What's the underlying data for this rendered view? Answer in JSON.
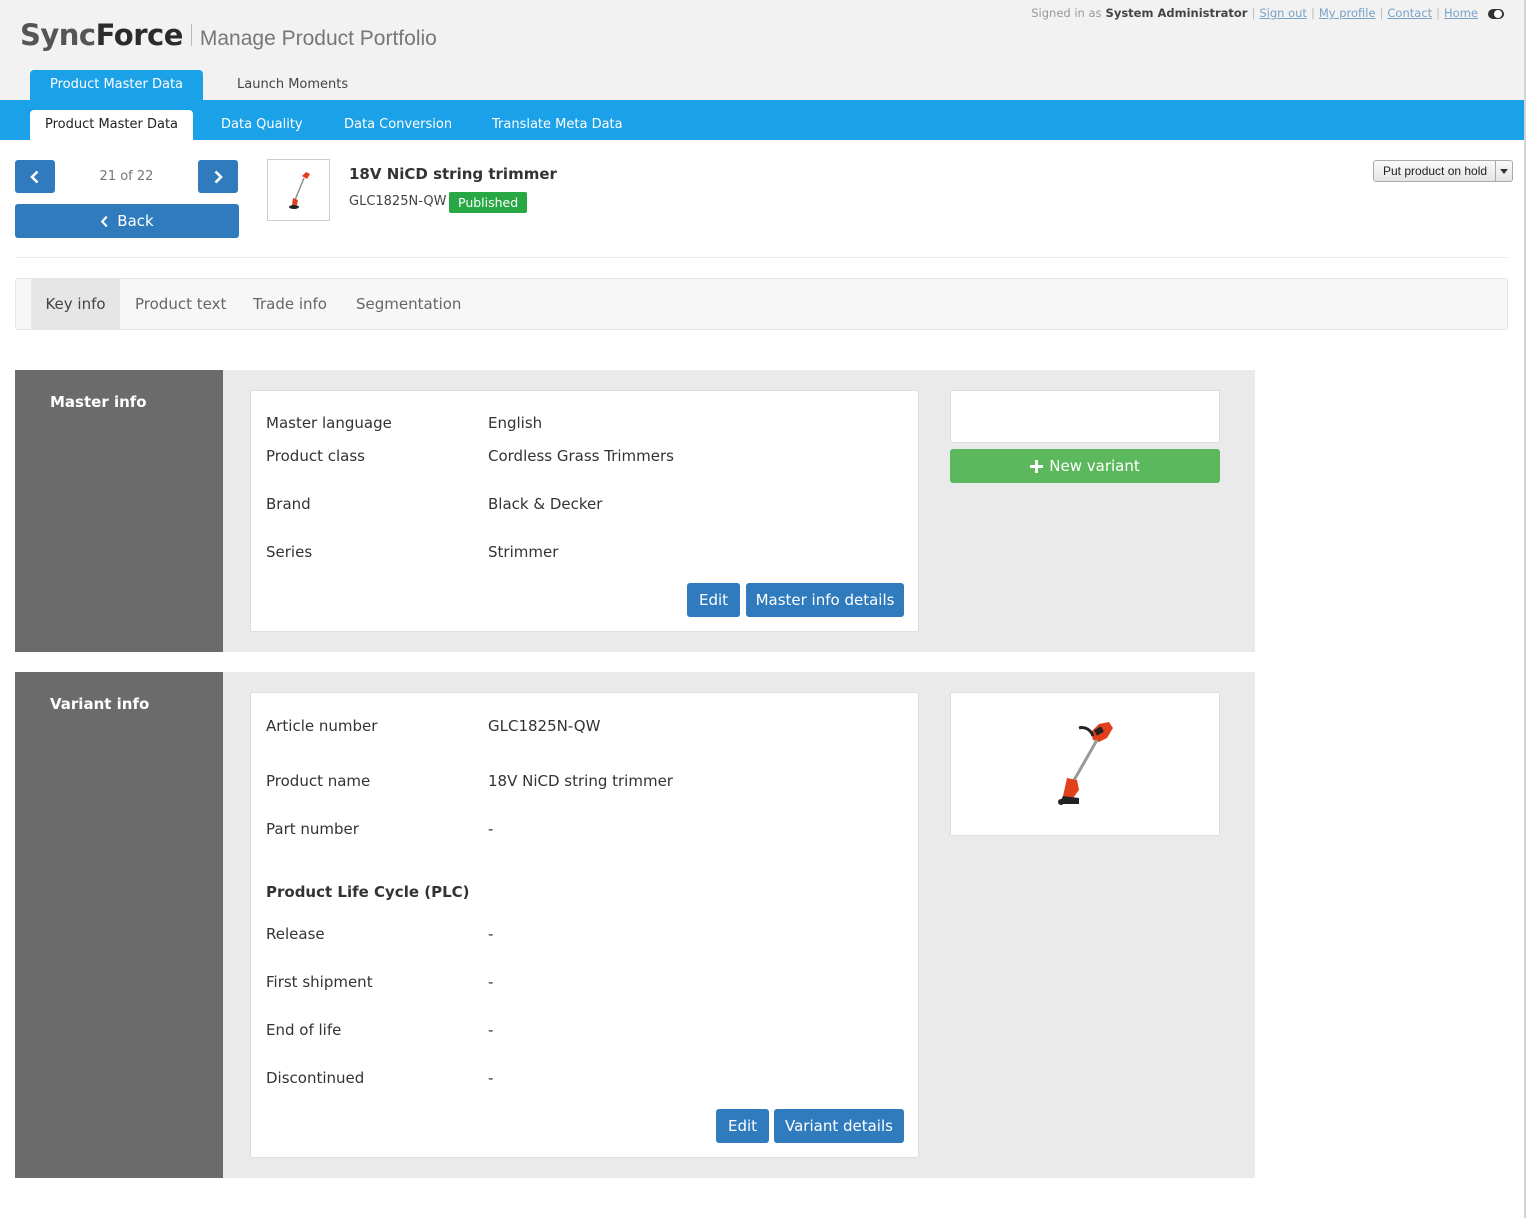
{
  "header": {
    "logo_sync": "Sync",
    "logo_force": "Force",
    "subtitle": "Manage Product Portfolio",
    "signed_in_prefix": "Signed in as",
    "user_name": "System Administrator",
    "links": {
      "sign_out": "Sign out",
      "my_profile": "My profile",
      "contact": "Contact",
      "home": "Home"
    },
    "separator": "|"
  },
  "top_tabs": [
    {
      "label": "Product Master Data",
      "active": true
    },
    {
      "label": "Launch Moments",
      "active": false
    }
  ],
  "sub_tabs": [
    {
      "label": "Product Master Data",
      "active": true
    },
    {
      "label": "Data Quality",
      "active": false
    },
    {
      "label": "Data Conversion",
      "active": false
    },
    {
      "label": "Translate Meta Data",
      "active": false
    }
  ],
  "pager": {
    "text": "21 of 22",
    "back_label": "Back"
  },
  "product": {
    "title": "18V NiCD string trimmer",
    "code": "GLC1825N-QW",
    "status": "Published",
    "status_color": "#28a745",
    "hold_label": "Put product on hold"
  },
  "key_tabs": [
    {
      "label": "Key info",
      "active": true
    },
    {
      "label": "Product text",
      "active": false
    },
    {
      "label": "Trade info",
      "active": false
    },
    {
      "label": "Segmentation",
      "active": false
    }
  ],
  "master_info": {
    "title": "Master info",
    "rows": [
      {
        "label": "Master language",
        "value": "English"
      },
      {
        "label": "Product class",
        "value": "Cordless Grass Trimmers"
      },
      {
        "label": "Brand",
        "value": "Black & Decker"
      },
      {
        "label": "Series",
        "value": "Strimmer"
      }
    ],
    "edit_label": "Edit",
    "details_label": "Master info details",
    "new_variant_label": "New variant"
  },
  "variant_info": {
    "title": "Variant info",
    "rows": [
      {
        "label": "Article number",
        "value": "GLC1825N-QW"
      },
      {
        "label": "Product name",
        "value": "18V NiCD string trimmer"
      },
      {
        "label": "Part number",
        "value": "-"
      }
    ],
    "plc_title": "Product Life Cycle (PLC)",
    "plc_rows": [
      {
        "label": "Release",
        "value": "-"
      },
      {
        "label": "First shipment",
        "value": "-"
      },
      {
        "label": "End of life",
        "value": "-"
      },
      {
        "label": "Discontinued",
        "value": "-"
      }
    ],
    "edit_label": "Edit",
    "details_label": "Variant details"
  },
  "colors": {
    "primary_blue": "#2f7bbd",
    "nav_blue": "#1aa1e8",
    "green": "#5cb85c",
    "sidebar_gray": "#6b6b6b"
  }
}
